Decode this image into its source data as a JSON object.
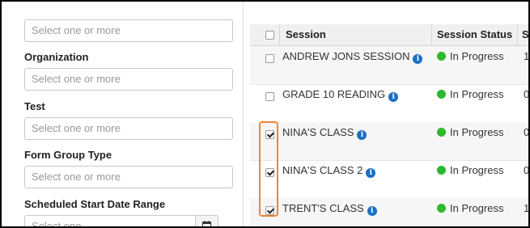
{
  "filters": {
    "session_placeholder": "Select one or more",
    "organization_label": "Organization",
    "organization_placeholder": "Select one or more",
    "test_label": "Test",
    "test_placeholder": "Select one or more",
    "form_group_label": "Form Group Type",
    "form_group_placeholder": "Select one or more",
    "date_range_label": "Scheduled Start Date Range",
    "date_placeholder": "Select one",
    "calendar_icon": "calendar-icon"
  },
  "table": {
    "headers": {
      "session": "Session",
      "status": "Session Status",
      "next": "S"
    },
    "rows": [
      {
        "session": "ANDREW JONS SESSION",
        "status": "In Progress",
        "next": "1",
        "checked": false
      },
      {
        "session": "GRADE 10 READING",
        "status": "In Progress",
        "next": "0",
        "checked": false
      },
      {
        "session": "NINA'S CLASS",
        "status": "In Progress",
        "next": "0",
        "checked": true
      },
      {
        "session": "NINA'S CLASS 2",
        "status": "In Progress",
        "next": "0",
        "checked": true
      },
      {
        "session": "TRENT'S CLASS",
        "status": "In Progress",
        "next": "1",
        "checked": true
      }
    ],
    "status_color": "#2eb82e",
    "info_icon_color": "#1a6fc2",
    "highlight_color": "#e8873a"
  }
}
